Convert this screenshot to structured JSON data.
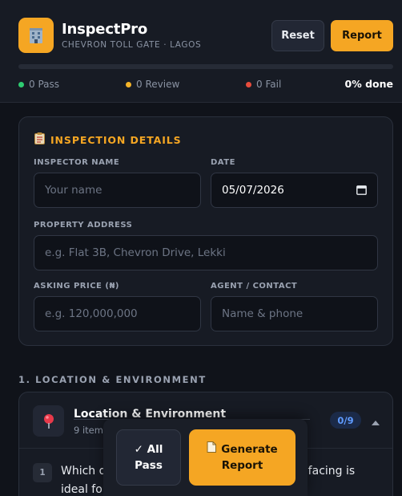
{
  "header": {
    "app_title": "InspectPro",
    "subtitle": "CHEVRON TOLL GATE · LAGOS",
    "logo_icon": "building-icon",
    "reset_label": "Reset",
    "report_label": "Report",
    "progress_percent": 0,
    "stats": {
      "pass": "0 Pass",
      "review": "0 Review",
      "fail": "0 Fail"
    },
    "done_label": "0% done"
  },
  "colors": {
    "accent": "#f5a623",
    "pass": "#2ecc71",
    "review": "#f5b428",
    "fail": "#e74c3c",
    "badge_text": "#5f9bff"
  },
  "details": {
    "title": "INSPECTION DETAILS",
    "title_icon": "clipboard-icon",
    "inspector_label": "INSPECTOR NAME",
    "inspector_placeholder": "Your name",
    "date_label": "DATE",
    "date_value": "05/07/2026",
    "address_label": "PROPERTY ADDRESS",
    "address_placeholder": "e.g. Flat 3B, Chevron Drive, Lekki",
    "price_label": "ASKING PRICE (₦)",
    "price_placeholder": "e.g. 120,000,000",
    "agent_label": "AGENT / CONTACT",
    "agent_placeholder": "Name & phone"
  },
  "section": {
    "heading": "1. LOCATION & ENVIRONMENT",
    "title": "Location & Environment",
    "subtitle": "9 items",
    "icon": "map-pin-icon",
    "count": "0/9",
    "question_number": "1",
    "question_text_line1_left": "Which d",
    "question_text_line1_right": "rth-facing is",
    "question_text_line2": "ideal for"
  },
  "actions": {
    "all_pass_label_1": "✓ All",
    "all_pass_label_2": "Pass",
    "generate_label_1": "Generate",
    "generate_label_2": "Report"
  }
}
